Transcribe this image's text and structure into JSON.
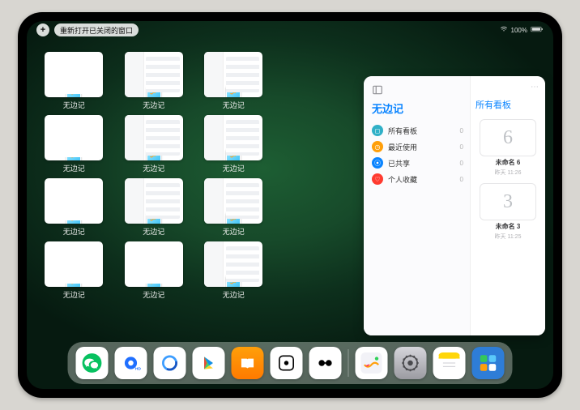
{
  "status": {
    "battery_pct": "100%"
  },
  "topbar": {
    "plus": "+",
    "reopen_label": "重新打开已关闭的窗口"
  },
  "window_label": "无边记",
  "windows": [
    {
      "kind": "blank"
    },
    {
      "kind": "split"
    },
    {
      "kind": "split"
    },
    null,
    {
      "kind": "blank"
    },
    {
      "kind": "split"
    },
    {
      "kind": "split"
    },
    null,
    {
      "kind": "blank"
    },
    {
      "kind": "split"
    },
    {
      "kind": "split"
    },
    null,
    {
      "kind": "blank"
    },
    {
      "kind": "blank"
    },
    {
      "kind": "split"
    }
  ],
  "panel": {
    "title": "无边记",
    "right_title": "所有看板",
    "items": [
      {
        "label": "所有看板",
        "count": "0",
        "color": "#30b0c7",
        "glyph": "◻"
      },
      {
        "label": "最近使用",
        "count": "0",
        "color": "#ff9f0a",
        "glyph": "◷"
      },
      {
        "label": "已共享",
        "count": "0",
        "color": "#0a84ff",
        "glyph": "⦿"
      },
      {
        "label": "个人收藏",
        "count": "0",
        "color": "#ff3b30",
        "glyph": "♡"
      }
    ],
    "boards": [
      {
        "name": "未命名 6",
        "sub": "昨天 11:26",
        "sketch": "6"
      },
      {
        "name": "未命名 3",
        "sub": "昨天 11:25",
        "sketch": "3"
      }
    ]
  },
  "dock": [
    {
      "id": "wechat",
      "bg": "#fff"
    },
    {
      "id": "qq-blue",
      "bg": "#fff"
    },
    {
      "id": "qb",
      "bg": "#fff"
    },
    {
      "id": "play",
      "bg": "#fff"
    },
    {
      "id": "books",
      "bg": "linear-gradient(180deg,#ff9f0a,#ff7a00)"
    },
    {
      "id": "dice",
      "bg": "#fff"
    },
    {
      "id": "bow",
      "bg": "#fff"
    },
    {
      "id": "freeform",
      "bg": "#fff"
    },
    {
      "id": "settings",
      "bg": "linear-gradient(180deg,#d6d6db,#9b9ba1)"
    },
    {
      "id": "notes",
      "bg": "#fff"
    },
    {
      "id": "folder",
      "bg": "#2e7dd7"
    }
  ]
}
